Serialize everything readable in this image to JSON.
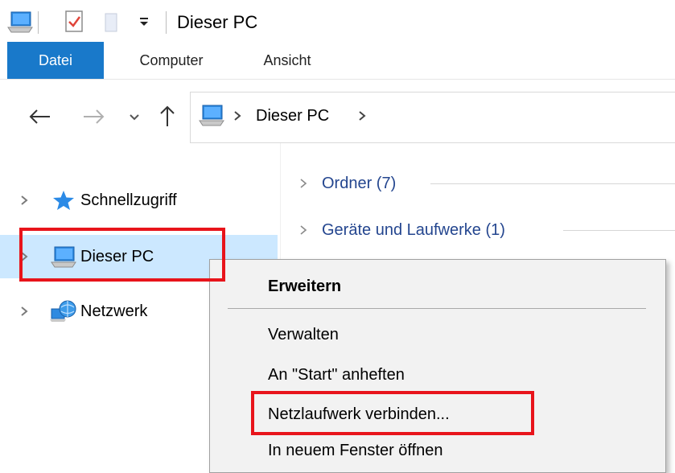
{
  "window": {
    "title": "Dieser PC"
  },
  "ribbon": {
    "tabs": [
      "Datei",
      "Computer",
      "Ansicht"
    ]
  },
  "address": {
    "location": "Dieser PC"
  },
  "navpane": {
    "items": [
      {
        "label": "Schnellzugriff",
        "icon": "star-icon"
      },
      {
        "label": "Dieser PC",
        "icon": "computer-icon",
        "selected": true
      },
      {
        "label": "Netzwerk",
        "icon": "network-icon"
      }
    ]
  },
  "content": {
    "groups": [
      {
        "label": "Ordner (7)"
      },
      {
        "label": "Geräte und Laufwerke (1)"
      }
    ]
  },
  "context_menu": {
    "items": [
      "Erweitern",
      "Verwalten",
      "An \"Start\" anheften",
      "Netzlaufwerk verbinden...",
      "In neuem Fenster öffnen"
    ]
  },
  "colors": {
    "accent": "#1979ca",
    "selection": "#cce8ff",
    "highlight": "#e8141b",
    "link": "#24468f"
  }
}
